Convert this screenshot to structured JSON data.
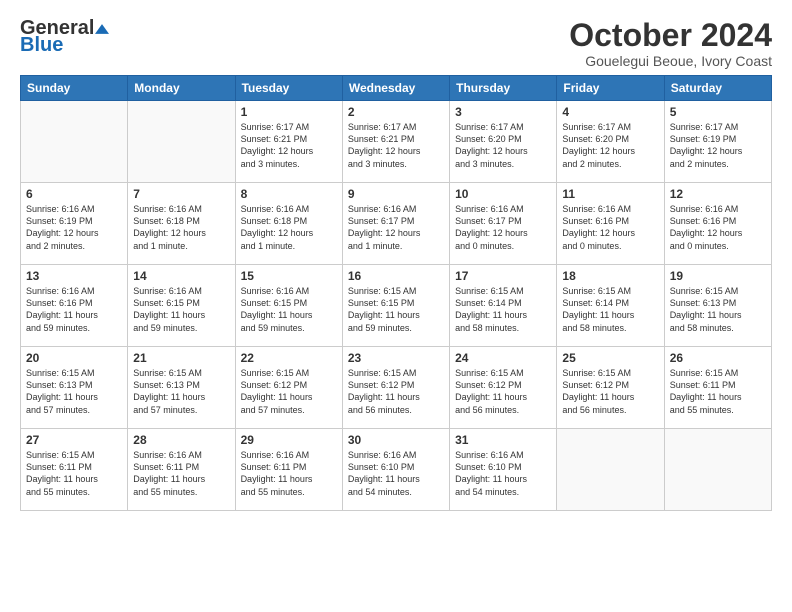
{
  "logo": {
    "general": "General",
    "blue": "Blue"
  },
  "title": "October 2024",
  "location": "Gouelegui Beoue, Ivory Coast",
  "headers": [
    "Sunday",
    "Monday",
    "Tuesday",
    "Wednesday",
    "Thursday",
    "Friday",
    "Saturday"
  ],
  "weeks": [
    [
      {
        "day": "",
        "info": ""
      },
      {
        "day": "",
        "info": ""
      },
      {
        "day": "1",
        "info": "Sunrise: 6:17 AM\nSunset: 6:21 PM\nDaylight: 12 hours\nand 3 minutes."
      },
      {
        "day": "2",
        "info": "Sunrise: 6:17 AM\nSunset: 6:21 PM\nDaylight: 12 hours\nand 3 minutes."
      },
      {
        "day": "3",
        "info": "Sunrise: 6:17 AM\nSunset: 6:20 PM\nDaylight: 12 hours\nand 3 minutes."
      },
      {
        "day": "4",
        "info": "Sunrise: 6:17 AM\nSunset: 6:20 PM\nDaylight: 12 hours\nand 2 minutes."
      },
      {
        "day": "5",
        "info": "Sunrise: 6:17 AM\nSunset: 6:19 PM\nDaylight: 12 hours\nand 2 minutes."
      }
    ],
    [
      {
        "day": "6",
        "info": "Sunrise: 6:16 AM\nSunset: 6:19 PM\nDaylight: 12 hours\nand 2 minutes."
      },
      {
        "day": "7",
        "info": "Sunrise: 6:16 AM\nSunset: 6:18 PM\nDaylight: 12 hours\nand 1 minute."
      },
      {
        "day": "8",
        "info": "Sunrise: 6:16 AM\nSunset: 6:18 PM\nDaylight: 12 hours\nand 1 minute."
      },
      {
        "day": "9",
        "info": "Sunrise: 6:16 AM\nSunset: 6:17 PM\nDaylight: 12 hours\nand 1 minute."
      },
      {
        "day": "10",
        "info": "Sunrise: 6:16 AM\nSunset: 6:17 PM\nDaylight: 12 hours\nand 0 minutes."
      },
      {
        "day": "11",
        "info": "Sunrise: 6:16 AM\nSunset: 6:16 PM\nDaylight: 12 hours\nand 0 minutes."
      },
      {
        "day": "12",
        "info": "Sunrise: 6:16 AM\nSunset: 6:16 PM\nDaylight: 12 hours\nand 0 minutes."
      }
    ],
    [
      {
        "day": "13",
        "info": "Sunrise: 6:16 AM\nSunset: 6:16 PM\nDaylight: 11 hours\nand 59 minutes."
      },
      {
        "day": "14",
        "info": "Sunrise: 6:16 AM\nSunset: 6:15 PM\nDaylight: 11 hours\nand 59 minutes."
      },
      {
        "day": "15",
        "info": "Sunrise: 6:16 AM\nSunset: 6:15 PM\nDaylight: 11 hours\nand 59 minutes."
      },
      {
        "day": "16",
        "info": "Sunrise: 6:15 AM\nSunset: 6:15 PM\nDaylight: 11 hours\nand 59 minutes."
      },
      {
        "day": "17",
        "info": "Sunrise: 6:15 AM\nSunset: 6:14 PM\nDaylight: 11 hours\nand 58 minutes."
      },
      {
        "day": "18",
        "info": "Sunrise: 6:15 AM\nSunset: 6:14 PM\nDaylight: 11 hours\nand 58 minutes."
      },
      {
        "day": "19",
        "info": "Sunrise: 6:15 AM\nSunset: 6:13 PM\nDaylight: 11 hours\nand 58 minutes."
      }
    ],
    [
      {
        "day": "20",
        "info": "Sunrise: 6:15 AM\nSunset: 6:13 PM\nDaylight: 11 hours\nand 57 minutes."
      },
      {
        "day": "21",
        "info": "Sunrise: 6:15 AM\nSunset: 6:13 PM\nDaylight: 11 hours\nand 57 minutes."
      },
      {
        "day": "22",
        "info": "Sunrise: 6:15 AM\nSunset: 6:12 PM\nDaylight: 11 hours\nand 57 minutes."
      },
      {
        "day": "23",
        "info": "Sunrise: 6:15 AM\nSunset: 6:12 PM\nDaylight: 11 hours\nand 56 minutes."
      },
      {
        "day": "24",
        "info": "Sunrise: 6:15 AM\nSunset: 6:12 PM\nDaylight: 11 hours\nand 56 minutes."
      },
      {
        "day": "25",
        "info": "Sunrise: 6:15 AM\nSunset: 6:12 PM\nDaylight: 11 hours\nand 56 minutes."
      },
      {
        "day": "26",
        "info": "Sunrise: 6:15 AM\nSunset: 6:11 PM\nDaylight: 11 hours\nand 55 minutes."
      }
    ],
    [
      {
        "day": "27",
        "info": "Sunrise: 6:15 AM\nSunset: 6:11 PM\nDaylight: 11 hours\nand 55 minutes."
      },
      {
        "day": "28",
        "info": "Sunrise: 6:16 AM\nSunset: 6:11 PM\nDaylight: 11 hours\nand 55 minutes."
      },
      {
        "day": "29",
        "info": "Sunrise: 6:16 AM\nSunset: 6:11 PM\nDaylight: 11 hours\nand 55 minutes."
      },
      {
        "day": "30",
        "info": "Sunrise: 6:16 AM\nSunset: 6:10 PM\nDaylight: 11 hours\nand 54 minutes."
      },
      {
        "day": "31",
        "info": "Sunrise: 6:16 AM\nSunset: 6:10 PM\nDaylight: 11 hours\nand 54 minutes."
      },
      {
        "day": "",
        "info": ""
      },
      {
        "day": "",
        "info": ""
      }
    ]
  ]
}
